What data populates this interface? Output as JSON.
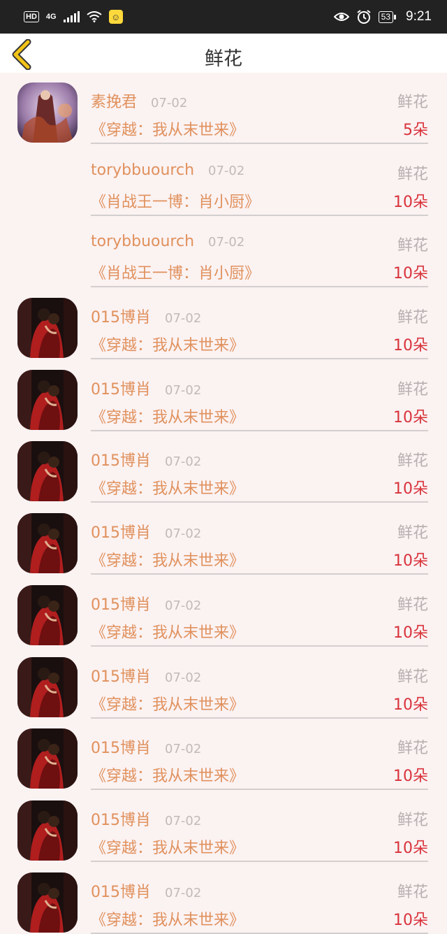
{
  "status_bar": {
    "hd": "HD",
    "network": "4G",
    "battery": "53",
    "time": "9:21",
    "icons": [
      "hd-icon",
      "signal-icon",
      "wifi-icon",
      "emoji-notification-icon",
      "eye-icon",
      "alarm-icon",
      "battery-icon"
    ]
  },
  "header": {
    "title": "鲜花",
    "back_icon": "chevron-left-icon"
  },
  "colors": {
    "accent": "#e0915d",
    "amount": "#d8333b",
    "back": "#f2c318",
    "background": "#fbf2f2"
  },
  "records": [
    {
      "avatar": "avatar-fantasy-figure",
      "name": "素挽君",
      "date": "07-02",
      "type": "鲜花",
      "book": "《穿越：我从末世来》",
      "amount": "5朵"
    },
    {
      "avatar": "none",
      "name": "torybbuourch",
      "date": "07-02",
      "type": "鲜花",
      "book": "《肖战王一博：肖小厨》",
      "amount": "10朵"
    },
    {
      "avatar": "none",
      "name": "torybbuourch",
      "date": "07-02",
      "type": "鲜花",
      "book": "《肖战王一博：肖小厨》",
      "amount": "10朵"
    },
    {
      "avatar": "avatar-couple-red",
      "name": "015博肖",
      "date": "07-02",
      "type": "鲜花",
      "book": "《穿越：我从末世来》",
      "amount": "10朵"
    },
    {
      "avatar": "avatar-couple-red",
      "name": "015博肖",
      "date": "07-02",
      "type": "鲜花",
      "book": "《穿越：我从末世来》",
      "amount": "10朵"
    },
    {
      "avatar": "avatar-couple-red",
      "name": "015博肖",
      "date": "07-02",
      "type": "鲜花",
      "book": "《穿越：我从末世来》",
      "amount": "10朵"
    },
    {
      "avatar": "avatar-couple-red",
      "name": "015博肖",
      "date": "07-02",
      "type": "鲜花",
      "book": "《穿越：我从末世来》",
      "amount": "10朵"
    },
    {
      "avatar": "avatar-couple-red",
      "name": "015博肖",
      "date": "07-02",
      "type": "鲜花",
      "book": "《穿越：我从末世来》",
      "amount": "10朵"
    },
    {
      "avatar": "avatar-couple-red",
      "name": "015博肖",
      "date": "07-02",
      "type": "鲜花",
      "book": "《穿越：我从末世来》",
      "amount": "10朵"
    },
    {
      "avatar": "avatar-couple-red",
      "name": "015博肖",
      "date": "07-02",
      "type": "鲜花",
      "book": "《穿越：我从末世来》",
      "amount": "10朵"
    },
    {
      "avatar": "avatar-couple-red",
      "name": "015博肖",
      "date": "07-02",
      "type": "鲜花",
      "book": "《穿越：我从末世来》",
      "amount": "10朵"
    },
    {
      "avatar": "avatar-couple-red",
      "name": "015博肖",
      "date": "07-02",
      "type": "鲜花",
      "book": "《穿越：我从末世来》",
      "amount": "10朵"
    }
  ]
}
